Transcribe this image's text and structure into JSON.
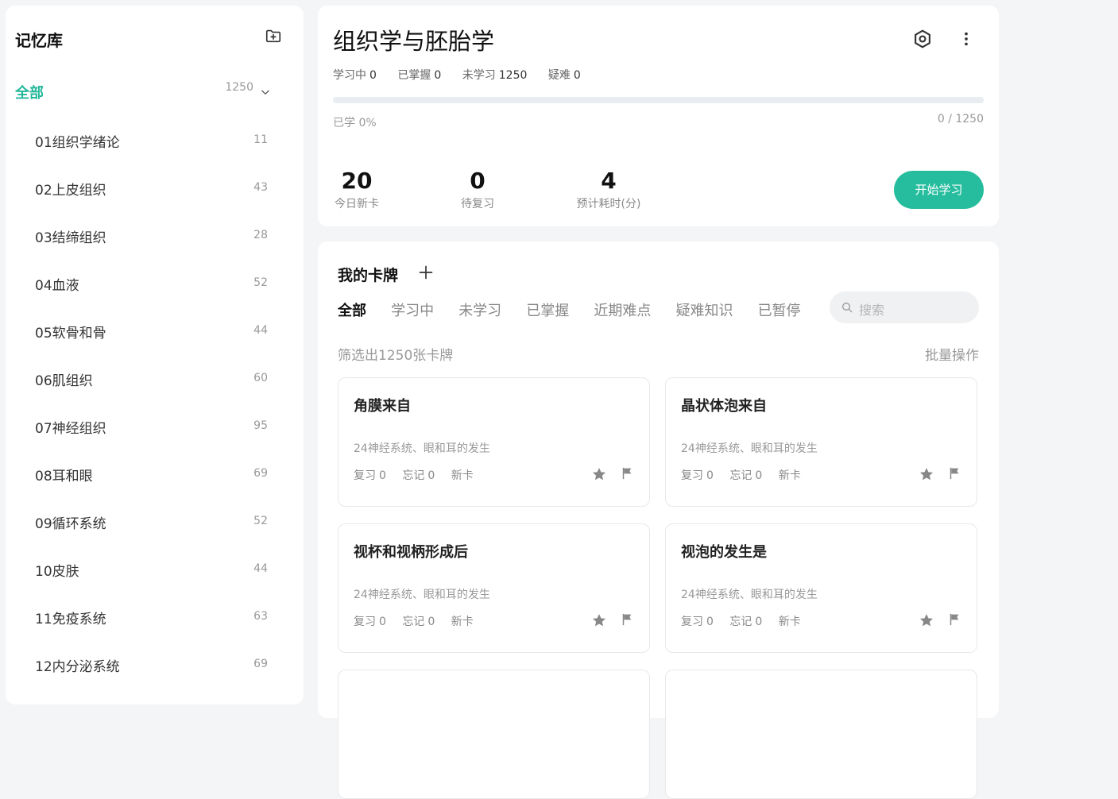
{
  "sidebar": {
    "title": "记忆库",
    "all": {
      "label": "全部",
      "count": "1250"
    },
    "items": [
      {
        "name": "01组织学绪论",
        "count": "11"
      },
      {
        "name": "02上皮组织",
        "count": "43"
      },
      {
        "name": "03结缔组织",
        "count": "28"
      },
      {
        "name": "04血液",
        "count": "52"
      },
      {
        "name": "05软骨和骨",
        "count": "44"
      },
      {
        "name": "06肌组织",
        "count": "60"
      },
      {
        "name": "07神经组织",
        "count": "95"
      },
      {
        "name": "08耳和眼",
        "count": "69"
      },
      {
        "name": "09循环系统",
        "count": "52"
      },
      {
        "name": "10皮肤",
        "count": "44"
      },
      {
        "name": "11免疫系统",
        "count": "63"
      },
      {
        "name": "12内分泌系统",
        "count": "69"
      }
    ]
  },
  "overview": {
    "title": "组织学与胚胎学",
    "stats": {
      "learning_label": "学习中",
      "learning": "0",
      "mastered_label": "已掌握",
      "mastered": "0",
      "unlearned_label": "未学习",
      "unlearned": "1250",
      "difficult_label": "疑难",
      "difficult": "0"
    },
    "progress": 0,
    "learned_text": "已学 0%",
    "ratio_text": "0 / 1250",
    "metrics": {
      "new_today": "20",
      "new_today_label": "今日新卡",
      "to_review": "0",
      "to_review_label": "待复习",
      "est_time": "4",
      "est_time_label": "预计耗时(分)"
    },
    "start_label": "开始学习"
  },
  "cards_panel": {
    "title": "我的卡牌",
    "tabs": [
      "全部",
      "学习中",
      "未学习",
      "已掌握",
      "近期难点",
      "疑难知识",
      "已暂停"
    ],
    "search_placeholder": "搜索",
    "filter_text": "筛选出1250张卡牌",
    "batch_label": "批量操作",
    "cards": [
      {
        "question": "角膜来自",
        "category": "24神经系统、眼和耳的发生",
        "review_label": "复习",
        "review": "0",
        "forget_label": "忘记",
        "forget": "0",
        "status": "新卡"
      },
      {
        "question": "晶状体泡来自",
        "category": "24神经系统、眼和耳的发生",
        "review_label": "复习",
        "review": "0",
        "forget_label": "忘记",
        "forget": "0",
        "status": "新卡"
      },
      {
        "question": "视杯和视柄形成后",
        "category": "24神经系统、眼和耳的发生",
        "review_label": "复习",
        "review": "0",
        "forget_label": "忘记",
        "forget": "0",
        "status": "新卡"
      },
      {
        "question": "视泡的发生是",
        "category": "24神经系统、眼和耳的发生",
        "review_label": "复习",
        "review": "0",
        "forget_label": "忘记",
        "forget": "0",
        "status": "新卡"
      }
    ]
  },
  "colors": {
    "accent": "#22b79a",
    "button": "#26bd9e"
  },
  "icons": {
    "add_folder": "folder-plus-icon",
    "settings": "gear-icon",
    "more": "more-vertical-icon",
    "add": "plus-icon",
    "search": "search-icon",
    "star": "star-icon",
    "flag": "flag-icon"
  }
}
